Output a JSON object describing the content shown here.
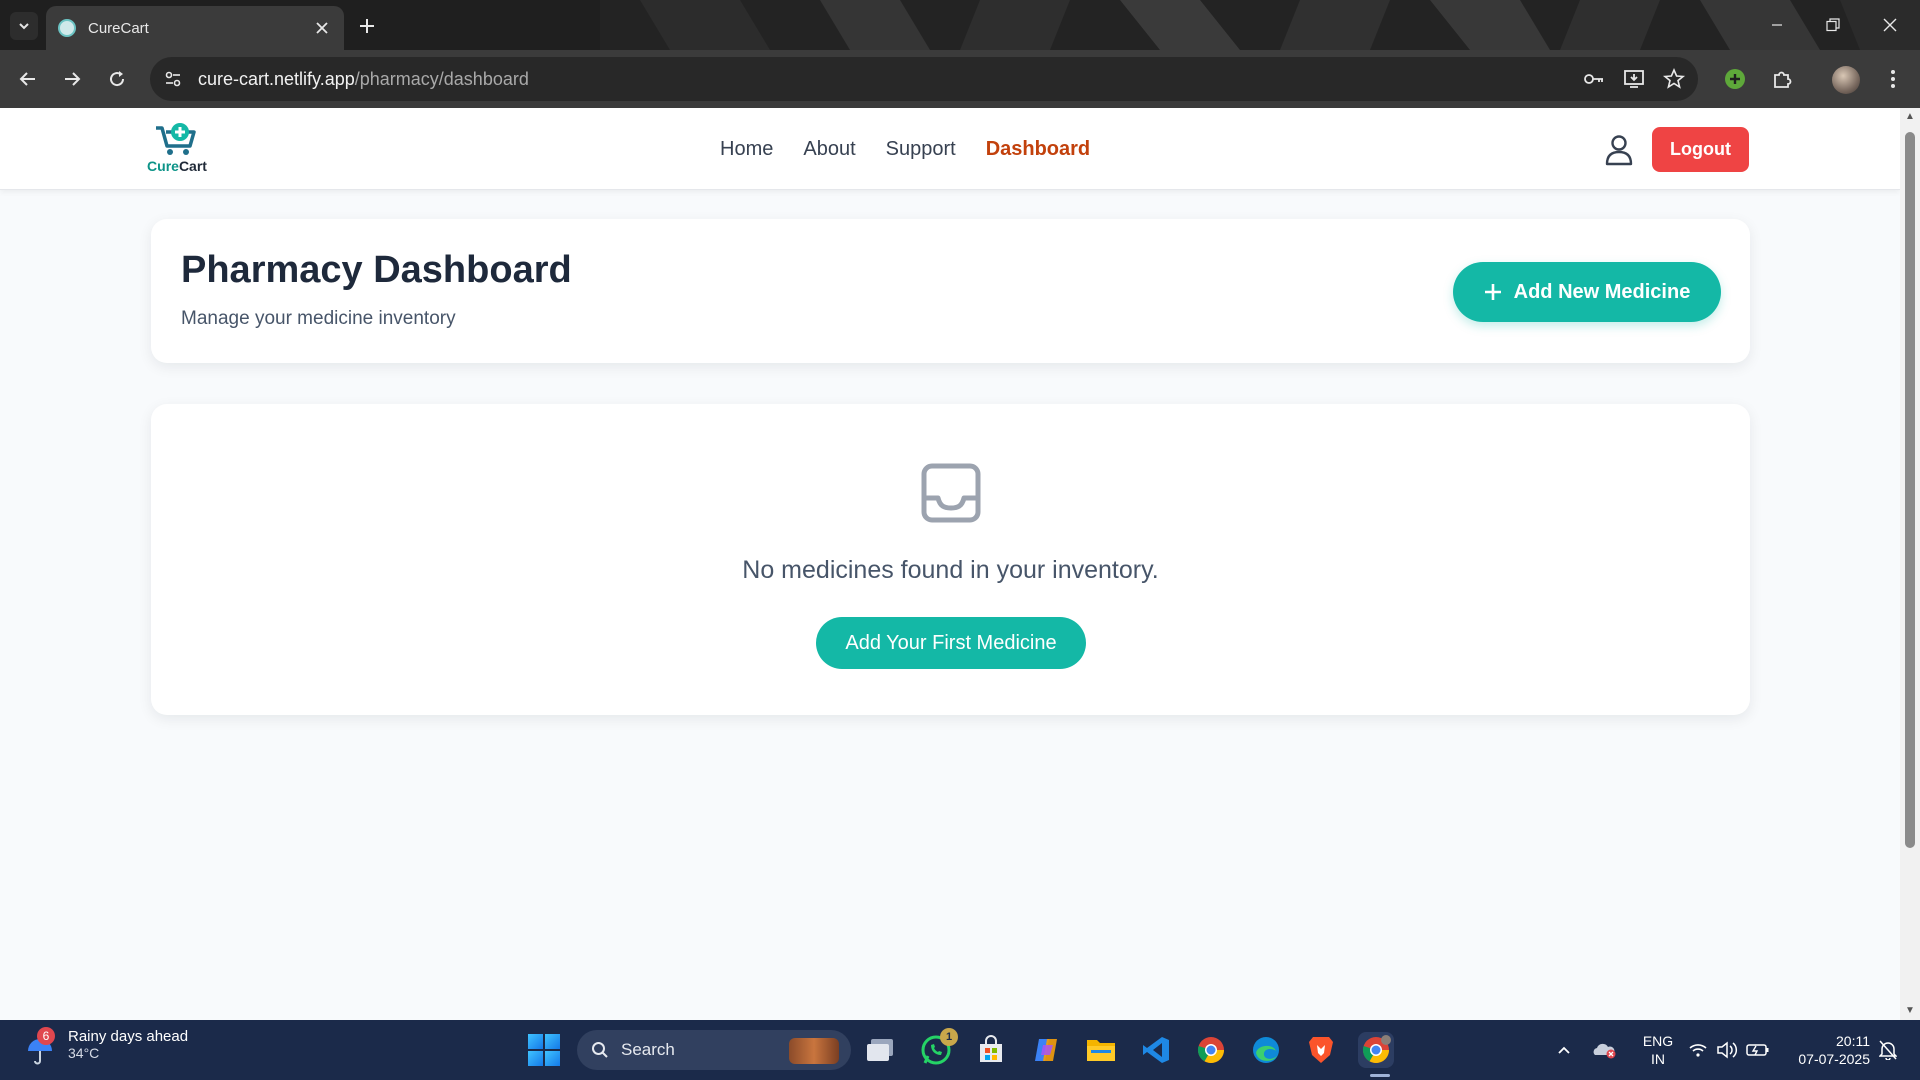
{
  "browser": {
    "tab_title": "CureCart",
    "url_host": "cure-cart.netlify.app",
    "url_path": "/pharmacy/dashboard"
  },
  "site": {
    "logo_text_a": "Cure",
    "logo_text_b": "Cart",
    "nav": [
      {
        "label": "Home",
        "active": false
      },
      {
        "label": "About",
        "active": false
      },
      {
        "label": "Support",
        "active": false
      },
      {
        "label": "Dashboard",
        "active": true
      }
    ],
    "logout_label": "Logout",
    "active_color": "#c2410c",
    "accent_color": "#14b8a6",
    "danger_color": "#ef4444"
  },
  "dashboard": {
    "title": "Pharmacy Dashboard",
    "subtitle": "Manage your medicine inventory",
    "add_button_label": "Add New Medicine",
    "empty_message": "No medicines found in your inventory.",
    "first_button_label": "Add Your First Medicine",
    "empty_icon": "inbox-icon"
  },
  "taskbar": {
    "weather_title": "Rainy days ahead",
    "weather_temp": "34°C",
    "weather_badge": "6",
    "search_placeholder": "Search",
    "whatsapp_badge": "1",
    "lang_line1": "ENG",
    "lang_line2": "IN",
    "time": "20:11",
    "date": "07-07-2025"
  }
}
